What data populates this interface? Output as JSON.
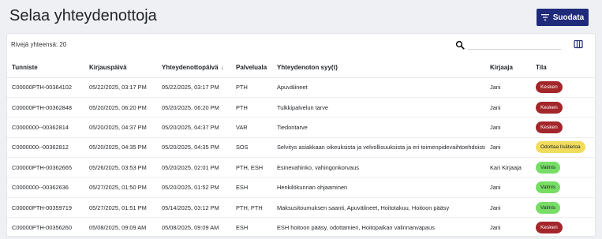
{
  "header": {
    "title": "Selaa yhteydenottoja",
    "filter_label": "Suodata"
  },
  "toolbar": {
    "row_count": "Rivejä yhteensä: 20",
    "search_placeholder": ""
  },
  "table": {
    "columns": [
      "Tunniste",
      "Kirjauspäivä",
      "Yhteydenottopäivä",
      "Palveluala",
      "Yhteydenoton syy(t)",
      "Kirjaaja",
      "Tila"
    ],
    "sort_indicator": "↓",
    "rows": [
      {
        "id": "C00000PTH-00364102",
        "logged": "05/22/2025, 03:17 PM",
        "contact": "05/22/2025, 03:17 PM",
        "area": "PTH",
        "reason": "Apuvälineet",
        "author": "Jani",
        "status": "Kesken",
        "status_color": "#a3262a",
        "status_text_color": "#ffffff"
      },
      {
        "id": "C00000PTH-00362848",
        "logged": "05/20/2025, 06:20 PM",
        "contact": "05/20/2025, 06:20 PM",
        "area": "PTH",
        "reason": "Tulkkipalvelun tarve",
        "author": "Jani",
        "status": "Kesken",
        "status_color": "#a3262a",
        "status_text_color": "#ffffff"
      },
      {
        "id": "C0000000--00362814",
        "logged": "05/20/2025, 04:37 PM",
        "contact": "05/20/2025, 04:37 PM",
        "area": "VAR",
        "reason": "Tiedontarve",
        "author": "Jani",
        "status": "Kesken",
        "status_color": "#a3262a",
        "status_text_color": "#ffffff"
      },
      {
        "id": "C0000000--00362812",
        "logged": "05/20/2025, 04:35 PM",
        "contact": "05/20/2025, 04:35 PM",
        "area": "SOS",
        "reason": "Selvitys asiakkaan oikeuksista ja velvollisuuksista ja eri toimenpidevaihtoehdoista",
        "author": "Jani",
        "status": "Odottaa lisätietoa",
        "status_color": "#f2dc5d",
        "status_text_color": "#1f2328"
      },
      {
        "id": "C00000PTH-00362665",
        "logged": "05/26/2025, 03:53 PM",
        "contact": "05/20/2025, 02:01 PM",
        "area": "PTH, ESH",
        "reason": "Esinevahinko, vahingonkorvaus",
        "author": "Kari Kirjaaja",
        "status": "Valmis",
        "status_color": "#77dd66",
        "status_text_color": "#1f2328"
      },
      {
        "id": "C0000000--00362636",
        "logged": "05/27/2025, 01:50 PM",
        "contact": "05/20/2025, 01:52 PM",
        "area": "ESH",
        "reason": "Henkilökunnan ohjaaminen",
        "author": "Jani",
        "status": "Valmis",
        "status_color": "#77dd66",
        "status_text_color": "#1f2328"
      },
      {
        "id": "C00000PTH-00359719",
        "logged": "05/27/2025, 01:51 PM",
        "contact": "05/14/2025, 03:12 PM",
        "area": "PTH, PTH",
        "reason": "Maksusitoumuksen saanti, Apuvälineet, Hoitotakuu, Hoitoon pääsy",
        "author": "Jani",
        "status": "Valmis",
        "status_color": "#77dd66",
        "status_text_color": "#1f2328"
      },
      {
        "id": "C00000PTH-00356260",
        "logged": "05/08/2025, 09:09 AM",
        "contact": "05/08/2025, 09:09 AM",
        "area": "ESH",
        "reason": "ESH hoitoon pääsy, odottamien, Hoitopaikan valinnanvapaus",
        "author": "Jani",
        "status": "Kesken",
        "status_color": "#a3262a",
        "status_text_color": "#ffffff"
      }
    ]
  },
  "colors": {
    "background": "#eef0f3",
    "primary_button": "#1f2a7a",
    "status_in_progress": "#a3262a",
    "status_waiting": "#f2dc5d",
    "status_done": "#77dd66"
  },
  "icons": {
    "filter": "filter-icon",
    "search": "search-icon",
    "columns": "columns-icon",
    "sort": "arrow-down-icon"
  }
}
